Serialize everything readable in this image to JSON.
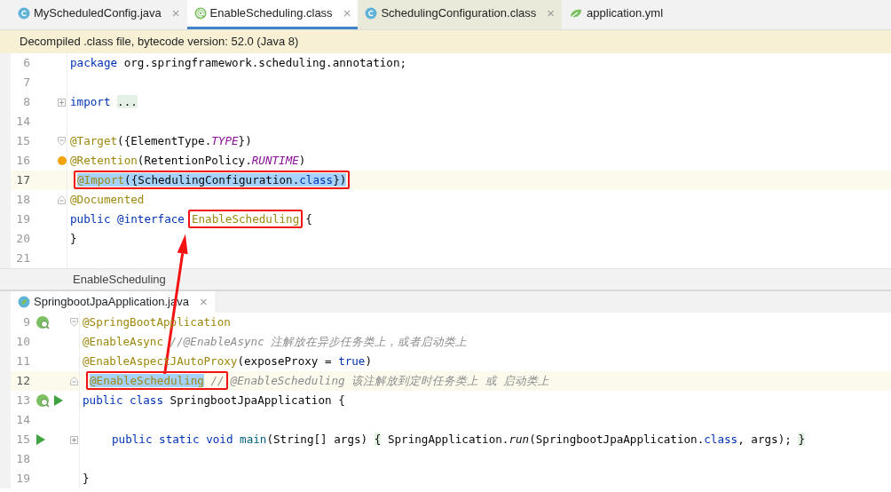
{
  "tabs": [
    {
      "label": "MyScheduledConfig.java",
      "kind": "class",
      "selected": false,
      "hovered": false,
      "close": "×"
    },
    {
      "label": "EnableScheduling.class",
      "kind": "annotation",
      "selected": true,
      "hovered": false,
      "close": "×"
    },
    {
      "label": "SchedulingConfiguration.class",
      "kind": "class",
      "selected": false,
      "hovered": true,
      "close": "×"
    },
    {
      "label": "application.yml",
      "kind": "yaml",
      "selected": false,
      "hovered": false
    }
  ],
  "banner": "Decompiled .class file, bytecode version: 52.0 (Java 8)",
  "editors": [
    {
      "lines": [
        {
          "num": "6",
          "tokens": [
            {
              "kind": "kw",
              "text": "package"
            },
            {
              "kind": "plain",
              "text": " org.springframework.scheduling.annotation;"
            }
          ]
        },
        {
          "num": "7"
        },
        {
          "num": "8",
          "fold": {
            "kind": "plus"
          },
          "tokens": [
            {
              "kind": "kw",
              "text": "import "
            },
            {
              "kind": "folded",
              "text": "..."
            }
          ]
        },
        {
          "num": "14"
        },
        {
          "num": "15",
          "fold": {
            "kind": "open"
          },
          "tokens": [
            {
              "kind": "ann",
              "text": "@Target"
            },
            {
              "kind": "plain",
              "text": "({ElementType."
            },
            {
              "kind": "const",
              "text": "TYPE"
            },
            {
              "kind": "plain",
              "text": "})"
            }
          ]
        },
        {
          "num": "16",
          "marker": {
            "kind": "bulb"
          },
          "tokens": [
            {
              "kind": "ann",
              "text": "@Retention"
            },
            {
              "kind": "plain",
              "text": "(RetentionPolicy."
            },
            {
              "kind": "const",
              "text": "RUNTIME"
            },
            {
              "kind": "plain",
              "text": ")"
            }
          ]
        },
        {
          "num": "17",
          "current": true,
          "tokens": [
            {
              "kind": "box",
              "tokens": [
                {
                  "kind": "ann",
                  "text": "@Import",
                  "selected": true
                },
                {
                  "kind": "plain",
                  "text": "({SchedulingConfiguration.",
                  "selected": true
                },
                {
                  "kind": "kw",
                  "text": "class",
                  "selected": true
                },
                {
                  "kind": "plain",
                  "text": "})",
                  "selected": true
                }
              ]
            }
          ]
        },
        {
          "num": "18",
          "fold": {
            "kind": "close"
          },
          "tokens": [
            {
              "kind": "ann",
              "text": "@Documented"
            }
          ]
        },
        {
          "num": "19",
          "tokens": [
            {
              "kind": "kw",
              "text": "public @interface"
            },
            {
              "kind": "box",
              "tokens": [
                {
                  "kind": "ann",
                  "text": "EnableScheduling"
                }
              ]
            },
            {
              "kind": "plain",
              "text": "{"
            }
          ]
        },
        {
          "num": "20",
          "tokens": [
            {
              "kind": "plain",
              "text": "}"
            }
          ]
        },
        {
          "num": "21"
        }
      ],
      "breadcrumb": "EnableScheduling"
    },
    {
      "tab": {
        "label": "SpringbootJpaApplication.java",
        "kind": "spring",
        "selected": true,
        "close": "×"
      },
      "lines": [
        {
          "num": "9",
          "gutter": [
            {
              "kind": "bean"
            }
          ],
          "fold": {
            "kind": "open"
          },
          "tokens": [
            {
              "kind": "ann",
              "text": "@SpringBootApplication"
            }
          ]
        },
        {
          "num": "10",
          "tokens": [
            {
              "kind": "ann",
              "text": "@EnableAsync "
            },
            {
              "kind": "comment",
              "text": "//@EnableAsync 注解放在异步任务类上，或者启动类上"
            }
          ]
        },
        {
          "num": "11",
          "tokens": [
            {
              "kind": "ann",
              "text": "@EnableAspectJAutoProxy"
            },
            {
              "kind": "plain",
              "text": "(exposeProxy = "
            },
            {
              "kind": "kw",
              "text": "true"
            },
            {
              "kind": "plain",
              "text": ")"
            }
          ]
        },
        {
          "num": "12",
          "current": true,
          "fold": {
            "kind": "close"
          },
          "tokens": [
            {
              "kind": "box",
              "tokens": [
                {
                  "kind": "ann",
                  "text": "@EnableScheduling",
                  "selected": true
                },
                {
                  "kind": "comment",
                  "text": " //"
                }
              ]
            },
            {
              "kind": "comment",
              "text": "@EnableScheduling 该注解放到定时任务类上 或 启动类上"
            }
          ]
        },
        {
          "num": "13",
          "gutter": [
            {
              "kind": "bean"
            },
            {
              "kind": "run"
            }
          ],
          "tokens": [
            {
              "kind": "kw",
              "text": "public class"
            },
            {
              "kind": "plain",
              "text": " SpringbootJpaApplication {"
            }
          ]
        },
        {
          "num": "14"
        },
        {
          "num": "15",
          "gutter": [
            {
              "kind": "run"
            }
          ],
          "fold": {
            "kind": "plus"
          },
          "indented": true,
          "tokens": [
            {
              "kind": "kw",
              "text": "public static void"
            },
            {
              "kind": "method",
              "text": " main"
            },
            {
              "kind": "plain",
              "text": "(String[] args) "
            },
            {
              "kind": "brace",
              "text": "{"
            },
            {
              "kind": "plain",
              "text": " SpringApplication."
            },
            {
              "kind": "italic",
              "text": "run"
            },
            {
              "kind": "plain",
              "text": "(SpringbootJpaApplication."
            },
            {
              "kind": "kw",
              "text": "class"
            },
            {
              "kind": "plain",
              "text": ", args); "
            },
            {
              "kind": "brace",
              "text": "}"
            }
          ]
        },
        {
          "num": "18"
        },
        {
          "num": "19",
          "tokens": [
            {
              "kind": "plain",
              "text": "}"
            }
          ]
        }
      ]
    }
  ]
}
